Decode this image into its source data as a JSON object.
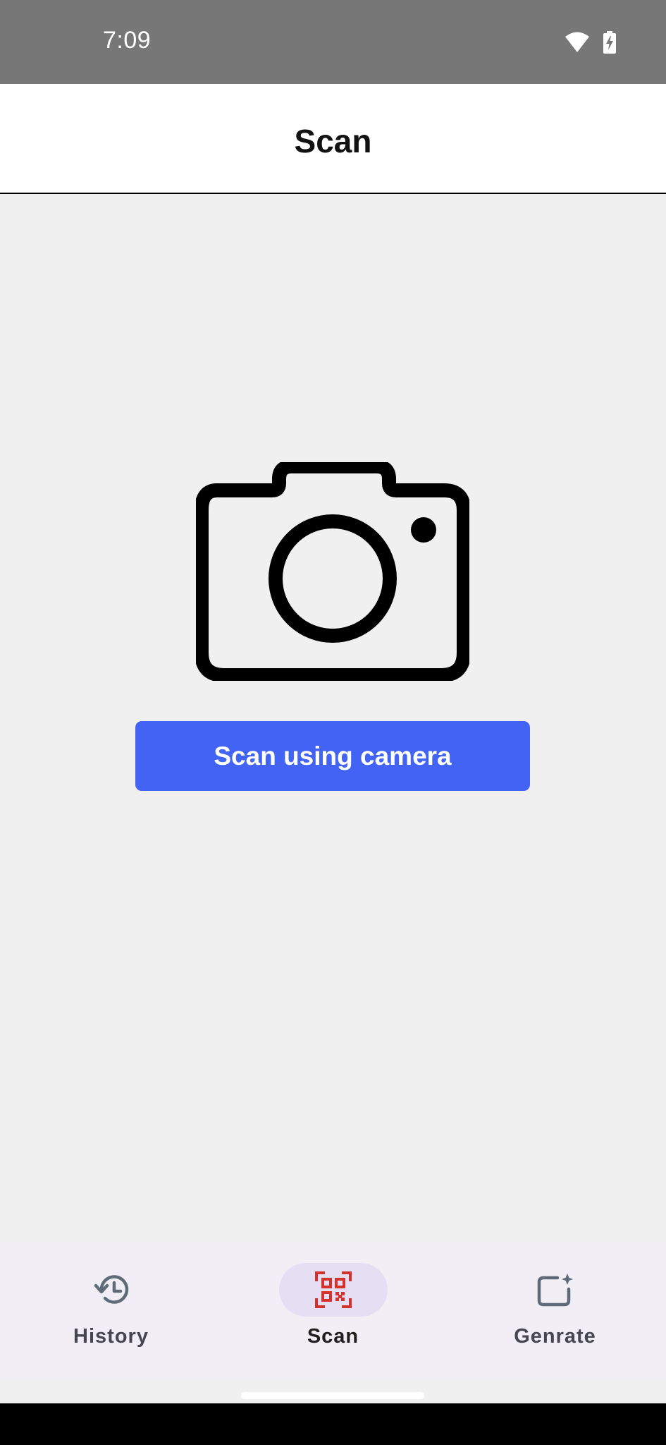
{
  "status_bar": {
    "time": "7:09",
    "icons": [
      "wifi-icon",
      "battery-charging-icon"
    ]
  },
  "app_bar": {
    "title": "Scan"
  },
  "main": {
    "illustration": "camera-icon",
    "scan_button_label": "Scan using camera"
  },
  "bottom_nav": {
    "items": [
      {
        "label": "History",
        "icon": "history-icon",
        "active": false
      },
      {
        "label": "Scan",
        "icon": "qr-scan-icon",
        "active": true
      },
      {
        "label": "Genrate",
        "icon": "generate-icon",
        "active": false
      }
    ]
  },
  "colors": {
    "primary_button": "#4263f3",
    "active_nav_indicator": "#e6def3",
    "active_nav_icon": "#d6322c",
    "status_bar": "#777777",
    "background": "#f0f0f0"
  }
}
